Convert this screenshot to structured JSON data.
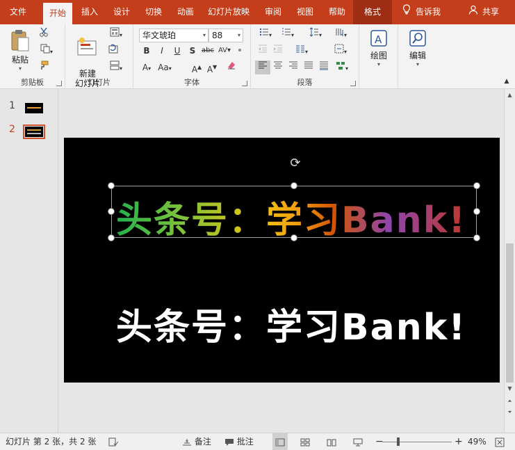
{
  "tabs": [
    "文件",
    "开始",
    "插入",
    "设计",
    "切换",
    "动画",
    "幻灯片放映",
    "审阅",
    "视图",
    "帮助",
    "格式"
  ],
  "active_tab": "开始",
  "tell_me": "告诉我",
  "share": "共享",
  "clipboard": {
    "paste_label": "粘贴",
    "group_label": "剪贴板"
  },
  "slides_group": {
    "new_slide_label": "新建\n幻灯片",
    "group_label": "幻灯片"
  },
  "font": {
    "font_name": "华文琥珀",
    "font_size": "88",
    "group_label": "字体"
  },
  "paragraph": {
    "group_label": "段落"
  },
  "drawing": {
    "label": "绘图"
  },
  "editing": {
    "label": "编辑"
  },
  "thumbnails": [
    {
      "num": "1"
    },
    {
      "num": "2"
    }
  ],
  "slide": {
    "title_colored": "头条号：学习Bank!",
    "title_white": "头条号：学习Bank!"
  },
  "status": {
    "slide_info": "幻灯片 第 2 张，共 2 张",
    "notes": "备注",
    "comments": "批注",
    "zoom": "49%"
  },
  "colors": {
    "accent": "#c43e1c",
    "selected_thumb": "#d35230"
  }
}
